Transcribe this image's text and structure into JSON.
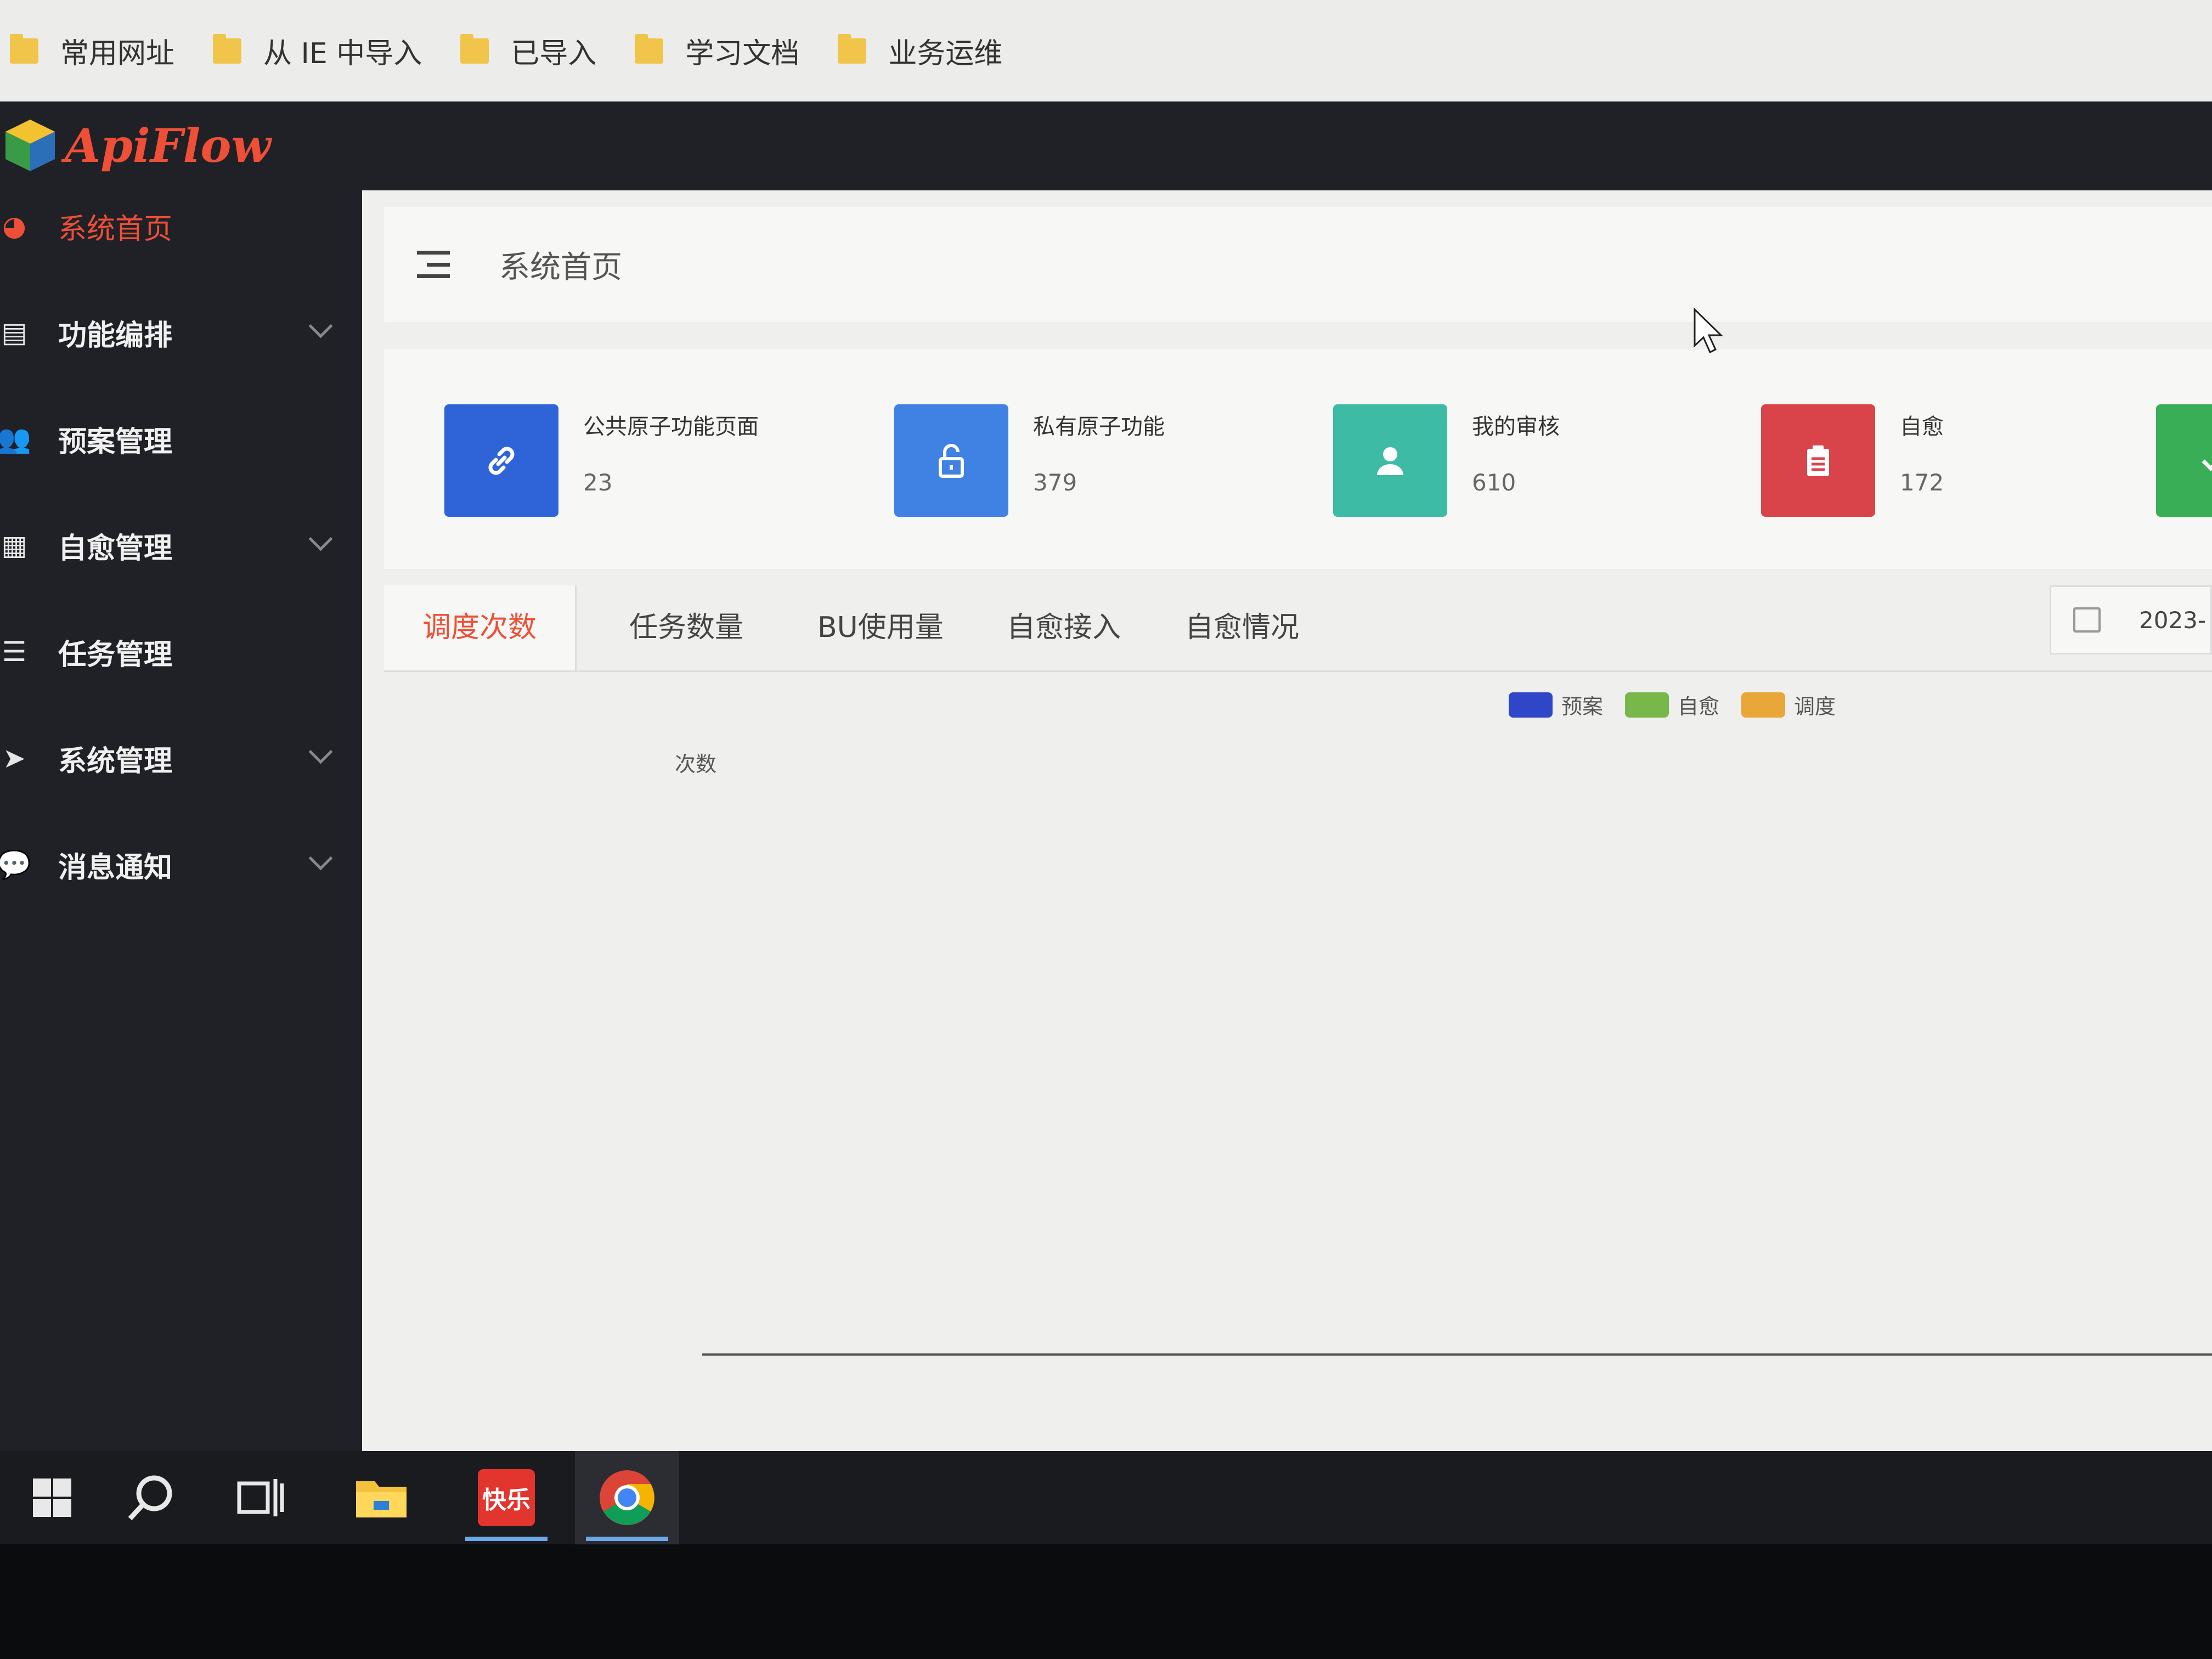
{
  "bookmarks": [
    {
      "label": "常用网址"
    },
    {
      "label": "从 IE 中导入"
    },
    {
      "label": "已导入"
    },
    {
      "label": "学习文档"
    },
    {
      "label": "业务运维"
    }
  ],
  "app": {
    "name": "ApiFlow"
  },
  "sidebar": {
    "items": [
      {
        "label": "系统首页",
        "icon": "dashboard-icon",
        "active": true
      },
      {
        "label": "功能编排",
        "icon": "document-icon",
        "expandable": true
      },
      {
        "label": "预案管理",
        "icon": "users-icon"
      },
      {
        "label": "自愈管理",
        "icon": "grid-icon",
        "expandable": true
      },
      {
        "label": "任务管理",
        "icon": "list-icon"
      },
      {
        "label": "系统管理",
        "icon": "send-icon",
        "expandable": true
      },
      {
        "label": "消息通知",
        "icon": "message-icon",
        "expandable": true
      }
    ]
  },
  "header": {
    "title": "系统首页"
  },
  "stats": [
    {
      "title": "公共原子功能页面",
      "value": "23",
      "icon": "link-icon",
      "color": "#2f64d8"
    },
    {
      "title": "私有原子功能",
      "value": "379",
      "icon": "unlock-icon",
      "color": "#3f82e4"
    },
    {
      "title": "我的审核",
      "value": "610",
      "icon": "user-icon",
      "color": "#3dbba5"
    },
    {
      "title": "自愈",
      "value": "172",
      "icon": "clipboard-icon",
      "color": "#d9444b"
    },
    {
      "title": "",
      "value": "",
      "icon": "check-icon",
      "color": "#3aae57"
    }
  ],
  "tabs": [
    {
      "label": "调度次数",
      "active": true
    },
    {
      "label": "任务数量"
    },
    {
      "label": "BU使用量"
    },
    {
      "label": "自愈接入"
    },
    {
      "label": "自愈情况"
    }
  ],
  "date_picker": {
    "value": "2023-"
  },
  "chart_data": {
    "type": "line",
    "ylabel": "次数",
    "series": [
      {
        "name": "预案",
        "color": "#2f46c8",
        "values": []
      },
      {
        "name": "自愈",
        "color": "#78b84a",
        "values": []
      },
      {
        "name": "调度",
        "color": "#e9a73a",
        "values": []
      }
    ],
    "legend_position": "top-right",
    "grid": false
  },
  "taskbar": {
    "items": [
      {
        "name": "windows-start",
        "icon": "windows-icon"
      },
      {
        "name": "search",
        "icon": "search-icon"
      },
      {
        "name": "task-view",
        "icon": "task-view-icon"
      },
      {
        "name": "file-explorer",
        "icon": "folder-icon"
      },
      {
        "name": "kuaile-app",
        "label": "快乐"
      },
      {
        "name": "chrome",
        "icon": "chrome-icon"
      }
    ]
  }
}
